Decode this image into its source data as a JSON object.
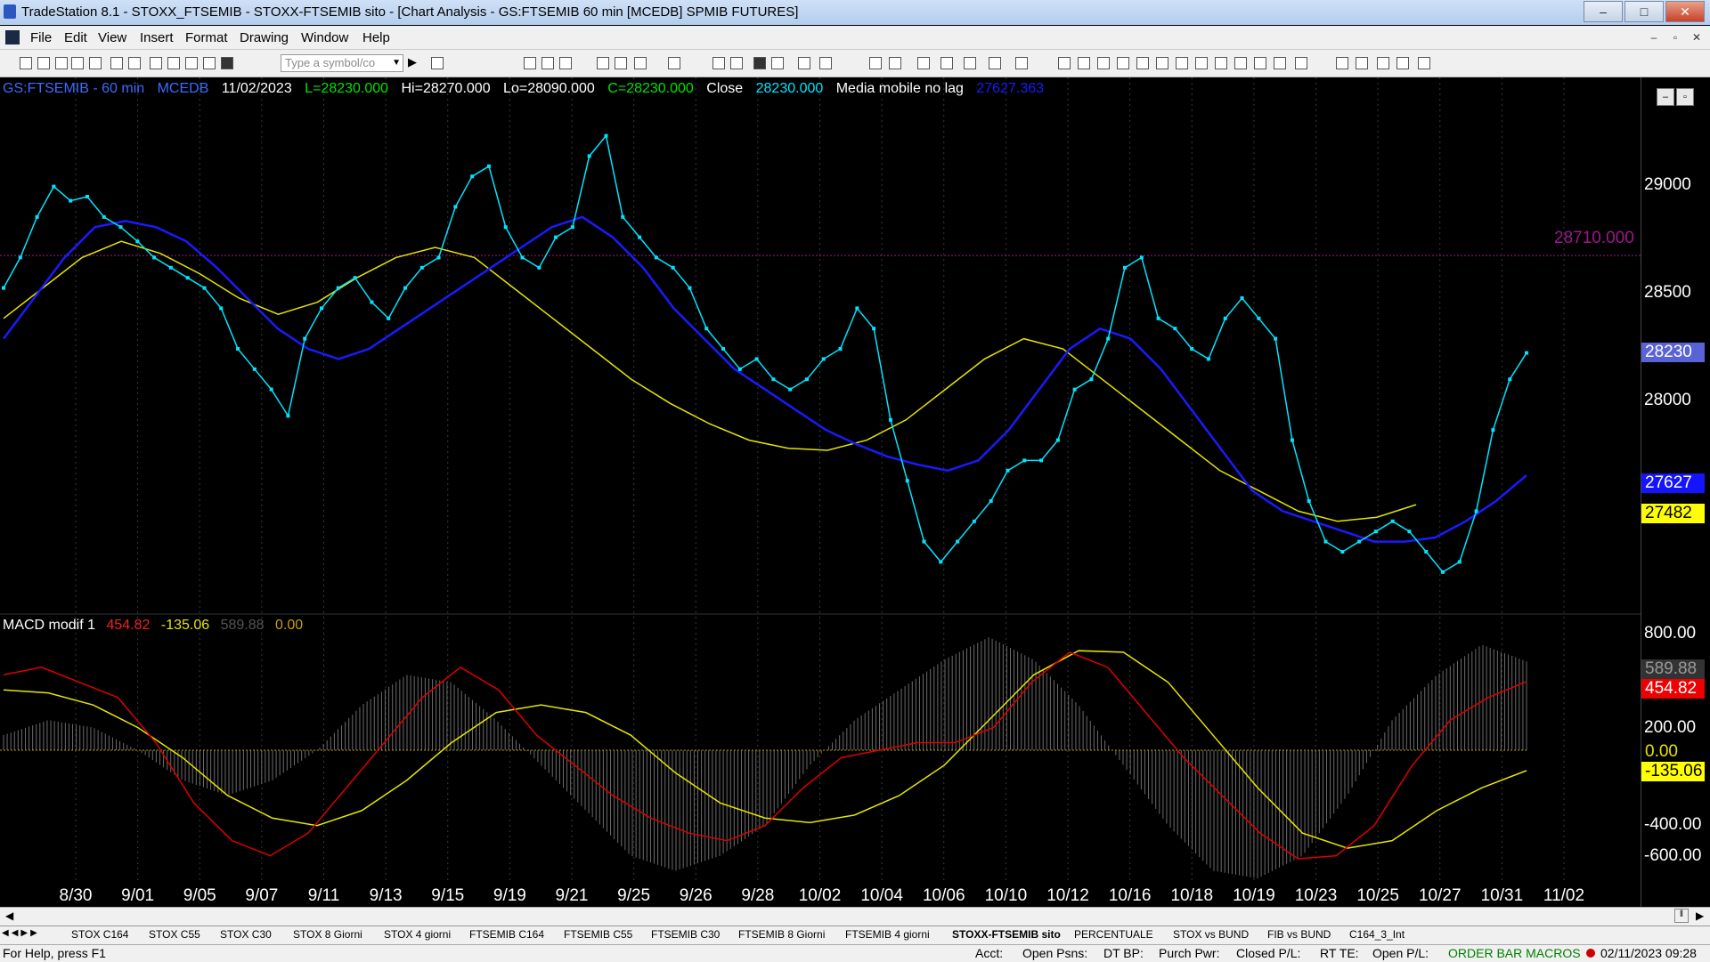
{
  "window": {
    "title": "TradeStation 8.1 - STOXX_FTSEMIB - STOXX-FTSEMIB sito - [Chart Analysis - GS:FTSEMIB  60 min  [MCEDB] SPMIB FUTURES]"
  },
  "menu": {
    "items": [
      "File",
      "Edit",
      "View",
      "Insert",
      "Format",
      "Drawing",
      "Window",
      "Help"
    ]
  },
  "toolbar": {
    "symbol_placeholder": "Type a symbol/co"
  },
  "chart_header": {
    "symbol": "GS:FTSEMIB - 60 min",
    "exchange": "MCEDB",
    "date": "11/02/2023",
    "last": "L=28230.000",
    "high": "Hi=28270.000",
    "low": "Lo=28090.000",
    "close_eq": "C=28230.000",
    "close_label": "Close",
    "close_val": "28230.000",
    "indicator": "Media mobile no lag",
    "indicator_val": "27627.363"
  },
  "macd_header": {
    "name": "MACD modif 1",
    "v1": "454.82",
    "v2": "-135.06",
    "v3": "589.88",
    "v4": "0.00"
  },
  "price_axis": {
    "ticks": [
      "29000",
      "28500",
      "28000"
    ],
    "line_label": "28710.000",
    "tags": [
      "28230",
      "27627",
      "27482"
    ]
  },
  "macd_axis": {
    "ticks": [
      "800.00",
      "200.00",
      "-400.00",
      "-600.00"
    ],
    "tags": [
      "589.88",
      "454.82",
      "0.00",
      "-135.06"
    ]
  },
  "x_axis": {
    "ticks": [
      "8/30",
      "9/01",
      "9/05",
      "9/07",
      "9/11",
      "9/13",
      "9/15",
      "9/19",
      "9/21",
      "9/25",
      "9/26",
      "9/28",
      "10/02",
      "10/04",
      "10/06",
      "10/10",
      "10/12",
      "10/16",
      "10/18",
      "10/19",
      "10/23",
      "10/25",
      "10/27",
      "10/31",
      "11/02"
    ]
  },
  "workspace_tabs": [
    "STOX C164",
    "STOX C55",
    "STOX  C30",
    "STOX  8 Giorni",
    "STOX 4 giorni",
    "FTSEMIB C164",
    "FTSEMIB C55",
    "FTSEMIB C30",
    "FTSEMIB  8 Giorni",
    "FTSEMIB  4 giorni",
    "STOXX-FTSEMIB sito",
    "PERCENTUALE",
    "STOX vs BUND",
    "FIB vs BUND",
    "C164_3_Int"
  ],
  "statusbar": {
    "help": "For Help, press F1",
    "acct": "Acct:",
    "open_psns": "Open Psns:",
    "dt_bp": "DT BP:",
    "purch_pwr": "Purch Pwr:",
    "closed_pl": "Closed P/L:",
    "rt_te": "RT TE:",
    "open_pl": "Open P/L:",
    "macros": "ORDER BAR  MACROS",
    "datetime": "02/11/2023 09:28"
  },
  "colors": {
    "price": "#00e5ff",
    "fast_ma": "#1a1aff",
    "slow_ma": "#e5e500",
    "macd": "#dd0000",
    "signal": "#e5e500",
    "histogram": "#888888"
  },
  "chart_data": [
    {
      "type": "line",
      "title": "GS:FTSEMIB - 60 min",
      "series": [
        {
          "name": "Close",
          "values": [
            28550,
            28700,
            28900,
            29050,
            28980,
            29000,
            28900,
            28850,
            28780,
            28700,
            28650,
            28600,
            28550,
            28450,
            28250,
            28150,
            28050,
            27920,
            28300,
            28450,
            28550,
            28600,
            28480,
            28400,
            28550,
            28650,
            28700,
            28950,
            29100,
            29150,
            28850,
            28700,
            28650,
            28800,
            28850,
            29200,
            29300,
            28900,
            28800,
            28700,
            28650,
            28550,
            28350,
            28250,
            28150,
            28200,
            28100,
            28050,
            28100,
            28200,
            28250,
            28450,
            28350,
            27900,
            27600,
            27300,
            27200,
            27300,
            27400,
            27500,
            27650,
            27700,
            27700,
            27800,
            28050,
            28100,
            28300,
            28650,
            28700,
            28400,
            28350,
            28250,
            28200,
            28400,
            28500,
            28400,
            28300,
            27800,
            27500,
            27300,
            27250,
            27300,
            27350,
            27400,
            27350,
            27250,
            27150,
            27200,
            27450,
            27850,
            28100,
            28230
          ]
        },
        {
          "name": "Media mobile no lag",
          "values": [
            28300,
            28500,
            28700,
            28850,
            28880,
            28850,
            28780,
            28650,
            28500,
            28350,
            28250,
            28200,
            28250,
            28350,
            28450,
            28550,
            28650,
            28750,
            28850,
            28900,
            28800,
            28650,
            28450,
            28300,
            28150,
            28050,
            27950,
            27850,
            27780,
            27720,
            27680,
            27650,
            27700,
            27850,
            28050,
            28250,
            28350,
            28300,
            28150,
            27950,
            27750,
            27550,
            27450,
            27400,
            27350,
            27300,
            27300,
            27320,
            27400,
            27500,
            27627
          ]
        },
        {
          "name": "",
          "values": [
            28400,
            28550,
            28700,
            28780,
            28720,
            28620,
            28500,
            28420,
            28480,
            28600,
            28700,
            28750,
            28700,
            28550,
            28400,
            28250,
            28100,
            27980,
            27880,
            27800,
            27760,
            27750,
            27800,
            27900,
            28050,
            28200,
            28300,
            28250,
            28100,
            27950,
            27800,
            27650,
            27550,
            27450,
            27400,
            27420,
            27482
          ]
        }
      ],
      "ylim": [
        27000,
        29500
      ],
      "h_line": 28710
    },
    {
      "type": "line",
      "title": "MACD modif 1",
      "series": [
        {
          "name": "",
          "values": [
            500,
            550,
            450,
            350,
            50,
            -350,
            -600,
            -700,
            -550,
            -250,
            50,
            350,
            550,
            400,
            100,
            -100,
            -300,
            -450,
            -550,
            -600,
            -500,
            -250,
            -50,
            0,
            50,
            50,
            150,
            450,
            650,
            550,
            250,
            -50,
            -300,
            -550,
            -720,
            -700,
            -500,
            -100,
            200,
            350,
            454.82
          ]
        },
        {
          "name": "",
          "values": [
            400,
            380,
            300,
            150,
            -50,
            -300,
            -450,
            -500,
            -400,
            -200,
            50,
            250,
            300,
            250,
            100,
            -150,
            -350,
            -450,
            -480,
            -430,
            -300,
            -100,
            200,
            500,
            660,
            650,
            450,
            100,
            -250,
            -550,
            -650,
            -600,
            -400,
            -250,
            -135.06
          ]
        },
        {
          "name": "",
          "values": [
            100,
            200,
            150,
            0,
            -200,
            -300,
            -200,
            0,
            300,
            500,
            450,
            200,
            -100,
            -400,
            -700,
            -800,
            -700,
            -500,
            -100,
            200,
            400,
            600,
            750,
            600,
            300,
            -100,
            -500,
            -800,
            -850,
            -700,
            -300,
            200,
            500,
            700,
            589.88
          ]
        }
      ],
      "ylim": [
        -850,
        850
      ]
    }
  ]
}
